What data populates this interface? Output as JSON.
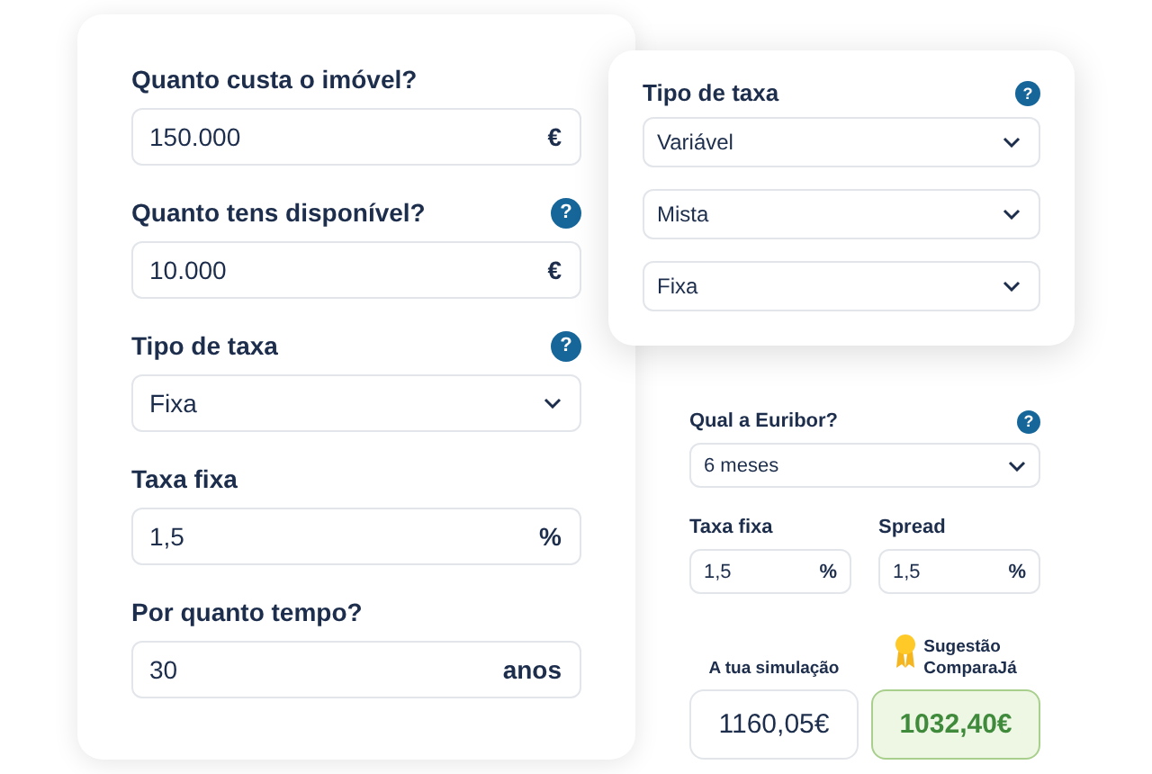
{
  "main_form": {
    "fields": [
      {
        "label": "Quanto custa o imóvel?",
        "kind": "input",
        "value": "150.000",
        "unit": "€"
      },
      {
        "label": "Quanto tens disponível?",
        "help": "?",
        "kind": "input",
        "value": "10.000",
        "unit": "€"
      },
      {
        "label": "Tipo de taxa",
        "help": "?",
        "kind": "select",
        "value": "Fixa"
      },
      {
        "label": "Taxa fixa",
        "kind": "input",
        "value": "1,5",
        "unit": "%"
      },
      {
        "label": "Por quanto tempo?",
        "kind": "input",
        "value": "30",
        "unit": "anos"
      }
    ]
  },
  "rate_popup": {
    "label": "Tipo de taxa",
    "help": "?",
    "options": [
      "Variável",
      "Mista",
      "Fixa"
    ]
  },
  "euribor": {
    "label": "Qual a Euribor?",
    "help": "?",
    "kind": "select",
    "value": "6 meses"
  },
  "rates": [
    {
      "label": "Taxa fixa",
      "kind": "input",
      "value": "1,5",
      "unit": "%"
    },
    {
      "label": "Spread",
      "kind": "input",
      "value": "1,5",
      "unit": "%"
    }
  ],
  "results": [
    {
      "label": "A tua simulação",
      "kind": "own",
      "value": "1160,05€"
    },
    {
      "label": "Sugestão ComparaJá",
      "kind": "suggested",
      "value": "1032,40€"
    }
  ]
}
